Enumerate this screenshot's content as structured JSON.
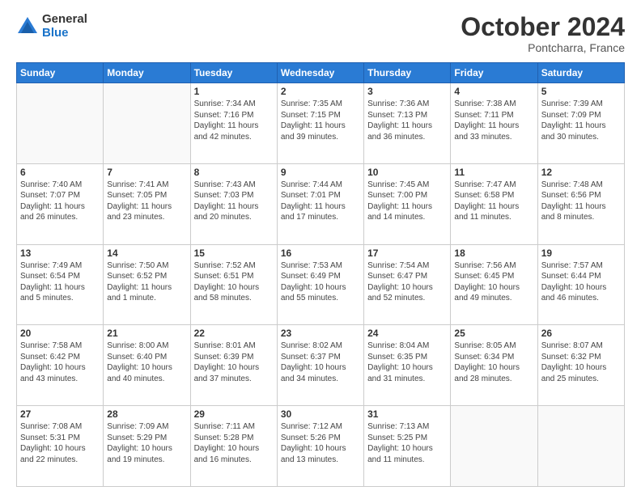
{
  "logo": {
    "general": "General",
    "blue": "Blue"
  },
  "header": {
    "month": "October 2024",
    "location": "Pontcharra, France"
  },
  "weekdays": [
    "Sunday",
    "Monday",
    "Tuesday",
    "Wednesday",
    "Thursday",
    "Friday",
    "Saturday"
  ],
  "weeks": [
    [
      {
        "day": null,
        "sunrise": null,
        "sunset": null,
        "daylight": null
      },
      {
        "day": null,
        "sunrise": null,
        "sunset": null,
        "daylight": null
      },
      {
        "day": "1",
        "sunrise": "Sunrise: 7:34 AM",
        "sunset": "Sunset: 7:16 PM",
        "daylight": "Daylight: 11 hours and 42 minutes."
      },
      {
        "day": "2",
        "sunrise": "Sunrise: 7:35 AM",
        "sunset": "Sunset: 7:15 PM",
        "daylight": "Daylight: 11 hours and 39 minutes."
      },
      {
        "day": "3",
        "sunrise": "Sunrise: 7:36 AM",
        "sunset": "Sunset: 7:13 PM",
        "daylight": "Daylight: 11 hours and 36 minutes."
      },
      {
        "day": "4",
        "sunrise": "Sunrise: 7:38 AM",
        "sunset": "Sunset: 7:11 PM",
        "daylight": "Daylight: 11 hours and 33 minutes."
      },
      {
        "day": "5",
        "sunrise": "Sunrise: 7:39 AM",
        "sunset": "Sunset: 7:09 PM",
        "daylight": "Daylight: 11 hours and 30 minutes."
      }
    ],
    [
      {
        "day": "6",
        "sunrise": "Sunrise: 7:40 AM",
        "sunset": "Sunset: 7:07 PM",
        "daylight": "Daylight: 11 hours and 26 minutes."
      },
      {
        "day": "7",
        "sunrise": "Sunrise: 7:41 AM",
        "sunset": "Sunset: 7:05 PM",
        "daylight": "Daylight: 11 hours and 23 minutes."
      },
      {
        "day": "8",
        "sunrise": "Sunrise: 7:43 AM",
        "sunset": "Sunset: 7:03 PM",
        "daylight": "Daylight: 11 hours and 20 minutes."
      },
      {
        "day": "9",
        "sunrise": "Sunrise: 7:44 AM",
        "sunset": "Sunset: 7:01 PM",
        "daylight": "Daylight: 11 hours and 17 minutes."
      },
      {
        "day": "10",
        "sunrise": "Sunrise: 7:45 AM",
        "sunset": "Sunset: 7:00 PM",
        "daylight": "Daylight: 11 hours and 14 minutes."
      },
      {
        "day": "11",
        "sunrise": "Sunrise: 7:47 AM",
        "sunset": "Sunset: 6:58 PM",
        "daylight": "Daylight: 11 hours and 11 minutes."
      },
      {
        "day": "12",
        "sunrise": "Sunrise: 7:48 AM",
        "sunset": "Sunset: 6:56 PM",
        "daylight": "Daylight: 11 hours and 8 minutes."
      }
    ],
    [
      {
        "day": "13",
        "sunrise": "Sunrise: 7:49 AM",
        "sunset": "Sunset: 6:54 PM",
        "daylight": "Daylight: 11 hours and 5 minutes."
      },
      {
        "day": "14",
        "sunrise": "Sunrise: 7:50 AM",
        "sunset": "Sunset: 6:52 PM",
        "daylight": "Daylight: 11 hours and 1 minute."
      },
      {
        "day": "15",
        "sunrise": "Sunrise: 7:52 AM",
        "sunset": "Sunset: 6:51 PM",
        "daylight": "Daylight: 10 hours and 58 minutes."
      },
      {
        "day": "16",
        "sunrise": "Sunrise: 7:53 AM",
        "sunset": "Sunset: 6:49 PM",
        "daylight": "Daylight: 10 hours and 55 minutes."
      },
      {
        "day": "17",
        "sunrise": "Sunrise: 7:54 AM",
        "sunset": "Sunset: 6:47 PM",
        "daylight": "Daylight: 10 hours and 52 minutes."
      },
      {
        "day": "18",
        "sunrise": "Sunrise: 7:56 AM",
        "sunset": "Sunset: 6:45 PM",
        "daylight": "Daylight: 10 hours and 49 minutes."
      },
      {
        "day": "19",
        "sunrise": "Sunrise: 7:57 AM",
        "sunset": "Sunset: 6:44 PM",
        "daylight": "Daylight: 10 hours and 46 minutes."
      }
    ],
    [
      {
        "day": "20",
        "sunrise": "Sunrise: 7:58 AM",
        "sunset": "Sunset: 6:42 PM",
        "daylight": "Daylight: 10 hours and 43 minutes."
      },
      {
        "day": "21",
        "sunrise": "Sunrise: 8:00 AM",
        "sunset": "Sunset: 6:40 PM",
        "daylight": "Daylight: 10 hours and 40 minutes."
      },
      {
        "day": "22",
        "sunrise": "Sunrise: 8:01 AM",
        "sunset": "Sunset: 6:39 PM",
        "daylight": "Daylight: 10 hours and 37 minutes."
      },
      {
        "day": "23",
        "sunrise": "Sunrise: 8:02 AM",
        "sunset": "Sunset: 6:37 PM",
        "daylight": "Daylight: 10 hours and 34 minutes."
      },
      {
        "day": "24",
        "sunrise": "Sunrise: 8:04 AM",
        "sunset": "Sunset: 6:35 PM",
        "daylight": "Daylight: 10 hours and 31 minutes."
      },
      {
        "day": "25",
        "sunrise": "Sunrise: 8:05 AM",
        "sunset": "Sunset: 6:34 PM",
        "daylight": "Daylight: 10 hours and 28 minutes."
      },
      {
        "day": "26",
        "sunrise": "Sunrise: 8:07 AM",
        "sunset": "Sunset: 6:32 PM",
        "daylight": "Daylight: 10 hours and 25 minutes."
      }
    ],
    [
      {
        "day": "27",
        "sunrise": "Sunrise: 7:08 AM",
        "sunset": "Sunset: 5:31 PM",
        "daylight": "Daylight: 10 hours and 22 minutes."
      },
      {
        "day": "28",
        "sunrise": "Sunrise: 7:09 AM",
        "sunset": "Sunset: 5:29 PM",
        "daylight": "Daylight: 10 hours and 19 minutes."
      },
      {
        "day": "29",
        "sunrise": "Sunrise: 7:11 AM",
        "sunset": "Sunset: 5:28 PM",
        "daylight": "Daylight: 10 hours and 16 minutes."
      },
      {
        "day": "30",
        "sunrise": "Sunrise: 7:12 AM",
        "sunset": "Sunset: 5:26 PM",
        "daylight": "Daylight: 10 hours and 13 minutes."
      },
      {
        "day": "31",
        "sunrise": "Sunrise: 7:13 AM",
        "sunset": "Sunset: 5:25 PM",
        "daylight": "Daylight: 10 hours and 11 minutes."
      },
      {
        "day": null,
        "sunrise": null,
        "sunset": null,
        "daylight": null
      },
      {
        "day": null,
        "sunrise": null,
        "sunset": null,
        "daylight": null
      }
    ]
  ]
}
